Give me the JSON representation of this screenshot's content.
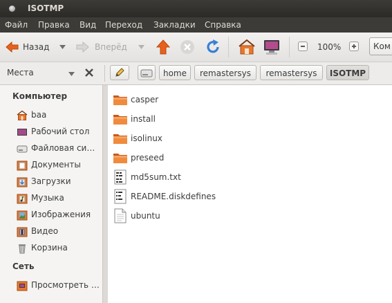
{
  "window": {
    "title": "ISOTMP"
  },
  "menu": [
    "Файл",
    "Правка",
    "Вид",
    "Переход",
    "Закладки",
    "Справка"
  ],
  "toolbar": {
    "back_label": "Назад",
    "forward_label": "Вперёд",
    "zoom_level": "100%",
    "view_select_value": "Ком"
  },
  "location": {
    "places_label": "Места",
    "breadcrumbs": [
      "home",
      "remastersys",
      "remastersys",
      "ISOTMP"
    ]
  },
  "sidebar": {
    "computer_heading": "Компьютер",
    "computer_items": [
      {
        "label": "baa",
        "icon": "home-folder-icon"
      },
      {
        "label": "Рабочий стол",
        "icon": "desktop-icon"
      },
      {
        "label": "Файловая си…",
        "icon": "filesystem-drive-icon"
      },
      {
        "label": "Документы",
        "icon": "documents-folder-icon"
      },
      {
        "label": "Загрузки",
        "icon": "downloads-folder-icon"
      },
      {
        "label": "Музыка",
        "icon": "music-folder-icon"
      },
      {
        "label": "Изображения",
        "icon": "pictures-folder-icon"
      },
      {
        "label": "Видео",
        "icon": "videos-folder-icon"
      },
      {
        "label": "Корзина",
        "icon": "trash-icon"
      }
    ],
    "network_heading": "Сеть",
    "network_items": [
      {
        "label": "Просмотреть …",
        "icon": "network-browse-icon"
      }
    ]
  },
  "files": [
    {
      "name": "casper",
      "icon": "folder-icon"
    },
    {
      "name": "install",
      "icon": "folder-icon"
    },
    {
      "name": "isolinux",
      "icon": "folder-icon"
    },
    {
      "name": "preseed",
      "icon": "folder-icon"
    },
    {
      "name": "md5sum.txt",
      "icon": "text-file-icon"
    },
    {
      "name": "README.diskdefines",
      "icon": "script-file-icon"
    },
    {
      "name": "ubuntu",
      "icon": "generic-file-icon"
    }
  ],
  "colors": {
    "titlebar": "#3c3b37",
    "folder_orange": "#e8772e",
    "accent_orange": "#e8601c",
    "text": "#3c3c3c"
  }
}
